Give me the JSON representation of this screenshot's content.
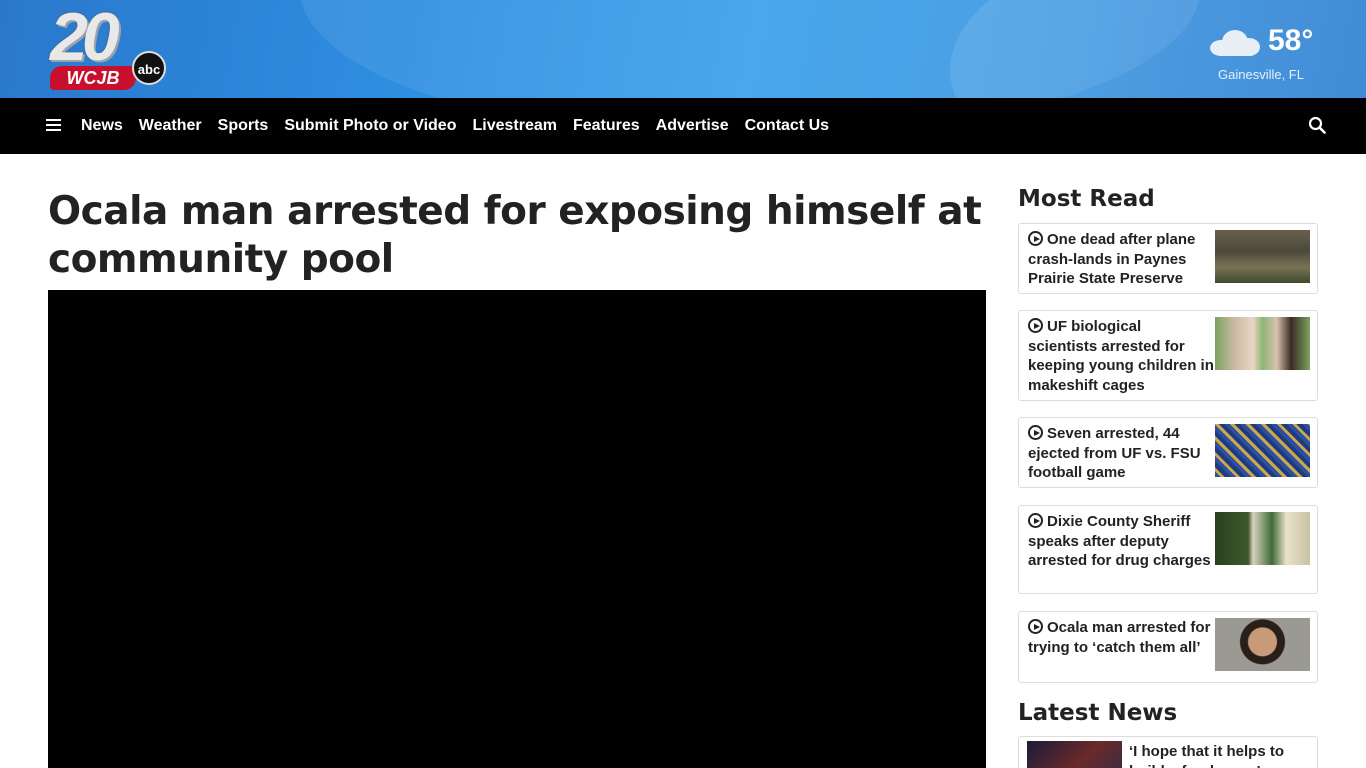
{
  "brand": {
    "channel": "20",
    "call_sign": "WCJB",
    "network": "abc"
  },
  "weather": {
    "icon": "cloud-icon",
    "temperature": "58°",
    "location": "Gainesville, FL"
  },
  "nav": {
    "menu_icon": "hamburger-icon",
    "search_icon": "search-icon",
    "items": [
      {
        "label": "News"
      },
      {
        "label": "Weather"
      },
      {
        "label": "Sports"
      },
      {
        "label": "Submit Photo or Video"
      },
      {
        "label": "Livestream"
      },
      {
        "label": "Features"
      },
      {
        "label": "Advertise"
      },
      {
        "label": "Contact Us"
      }
    ]
  },
  "article": {
    "headline": "Ocala man arrested for exposing himself at community pool"
  },
  "most_read": {
    "title": "Most Read",
    "items": [
      {
        "title": "One dead after plane crash-lands in Paynes Prairie State Preserve",
        "icon": "play-icon"
      },
      {
        "title": "UF biological scientists arrested for keeping young children in makeshift cages",
        "icon": "play-icon"
      },
      {
        "title": "Seven arrested, 44 ejected from UF vs. FSU football game",
        "icon": "play-icon"
      },
      {
        "title": "Dixie County Sheriff speaks after deputy arrested for drug charges",
        "icon": "play-icon"
      },
      {
        "title": "Ocala man arrested for trying to ‘catch them all’",
        "icon": "play-icon"
      }
    ]
  },
  "latest_news": {
    "title": "Latest News",
    "items": [
      {
        "title": "‘I hope that it helps to build a foodscape’"
      }
    ]
  }
}
